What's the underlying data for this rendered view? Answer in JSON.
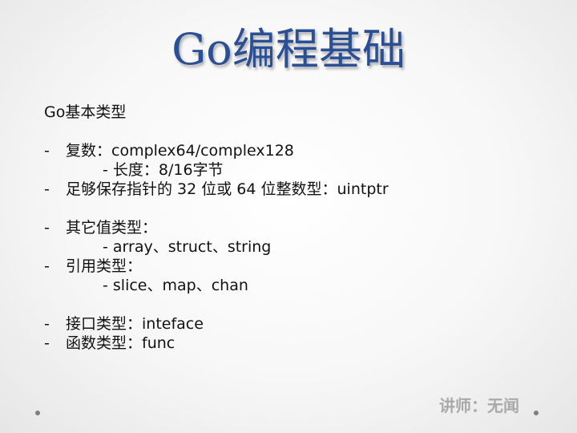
{
  "slide": {
    "title": "Go编程基础",
    "heading": "Go基本类型",
    "bullet_marker": "-",
    "items": [
      {
        "text": "复数：complex64/complex128"
      },
      {
        "text": "- 长度：8/16字节"
      },
      {
        "text": "足够保存指针的 32 位或 64 位整数型：uintptr"
      },
      {
        "text": "其它值类型："
      },
      {
        "text": "- array、struct、string"
      },
      {
        "text": "引用类型："
      },
      {
        "text": "- slice、map、chan"
      },
      {
        "text": "接口类型：inteface"
      },
      {
        "text": "函数类型：func"
      }
    ],
    "lecturer": "讲师：无闻"
  }
}
